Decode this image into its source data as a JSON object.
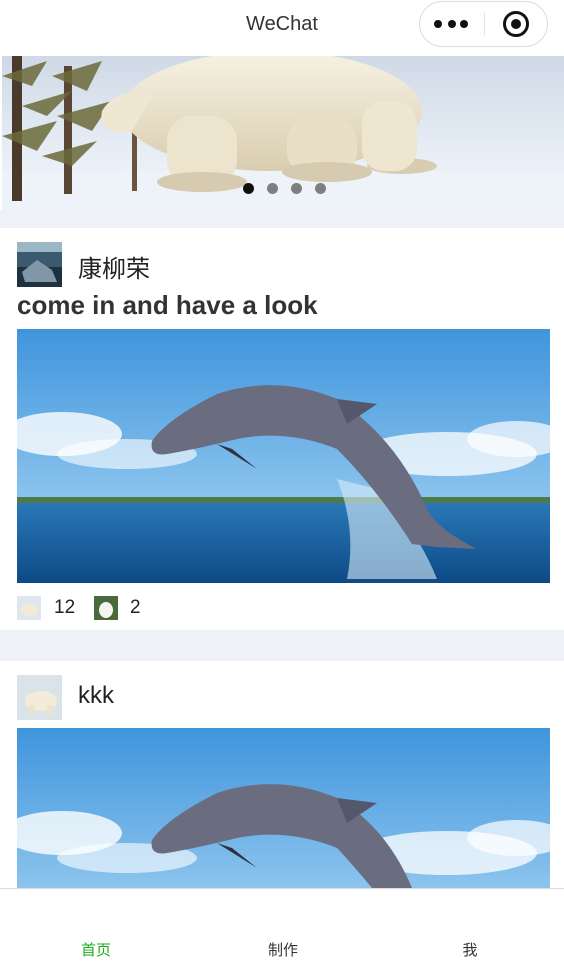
{
  "nav": {
    "title": "WeChat"
  },
  "colors": {
    "tab_active": "#1aad19",
    "page_gap": "#eef1f5",
    "text": "#333333"
  },
  "banner": {
    "dot_count": 4,
    "active_index": 0
  },
  "posts": [
    {
      "author": "康柳荣",
      "title": "come in and have a look",
      "stats": [
        {
          "icon": "polar-bear-thumb-icon",
          "count": "12"
        },
        {
          "icon": "wolf-thumb-icon",
          "count": "2"
        }
      ]
    },
    {
      "author": "kkk",
      "title": "",
      "stats": []
    }
  ],
  "tabbar": {
    "items": [
      {
        "label": "首页",
        "active": true
      },
      {
        "label": "制作",
        "active": false
      },
      {
        "label": "我",
        "active": false
      }
    ]
  }
}
